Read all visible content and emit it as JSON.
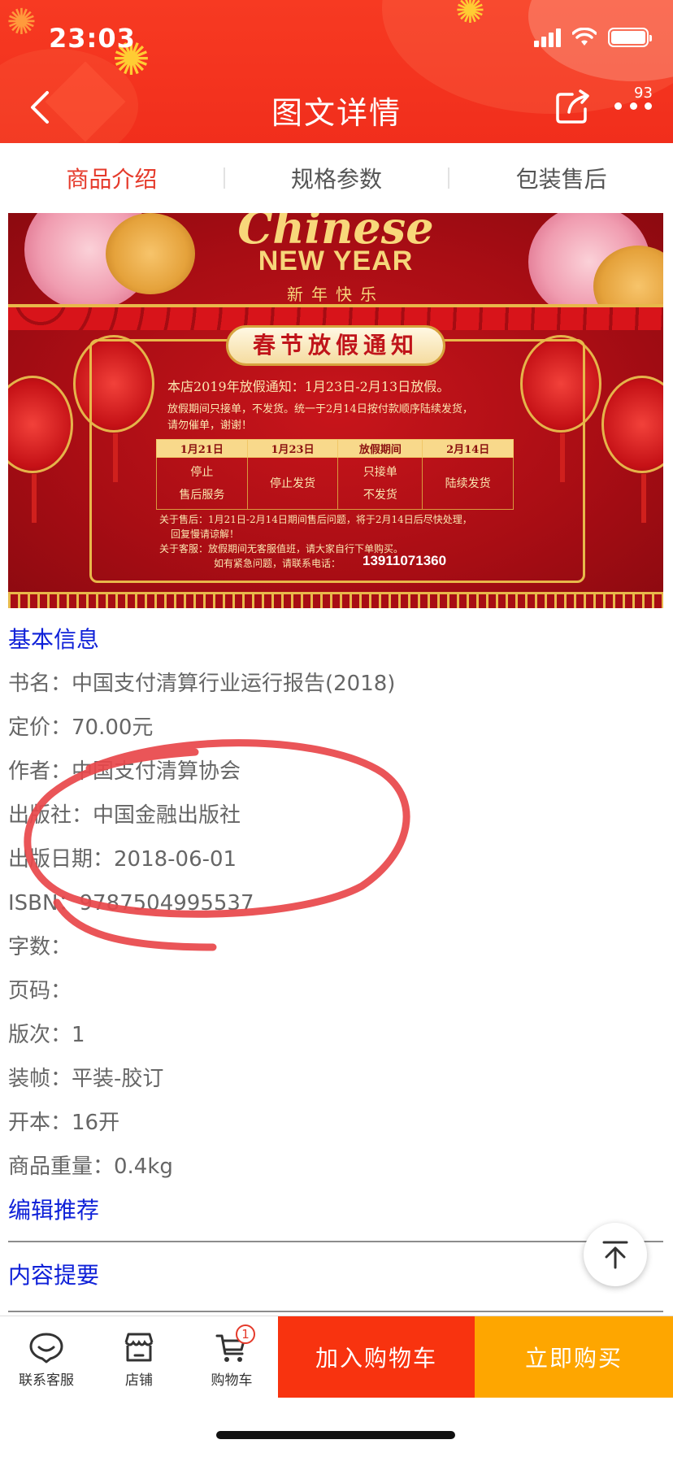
{
  "status_bar": {
    "time": "23:03"
  },
  "nav": {
    "title": "图文详情",
    "more_badge": "93"
  },
  "tabs": [
    {
      "label": "商品介绍",
      "active": true
    },
    {
      "label": "规格参数",
      "active": false
    },
    {
      "label": "包装售后",
      "active": false
    }
  ],
  "banner": {
    "script_text": "Chinese",
    "heading": "NEW YEAR",
    "subheading": "新年快乐",
    "notice_title": "春节放假通知",
    "line1": "本店2019年放假通知：1月23日-2月13日放假。",
    "line2": "放假期间只接单，不发货。统一于2月14日按付款顺序陆续发货，",
    "line3": "请勿催单，谢谢！",
    "table": {
      "headers": [
        "1月21日",
        "1月23日",
        "放假期间",
        "2月14日"
      ],
      "cells": [
        "停止\n售后服务",
        "停止发货",
        "只接单\n不发货",
        "陆续发货"
      ]
    },
    "after_sale": "关于售后：1月21日-2月14日期间售后问题，将于2月14日后尽快处理，",
    "after_sale_cont": "回复慢请谅解！",
    "customer_service": "关于客服：放假期间无客服值班，请大家自行下单购买。",
    "emergency": "如有紧急问题，请联系电话：",
    "phone": "13911071360"
  },
  "info": {
    "basic_title": "基本信息",
    "rows": [
      "书名：中国支付清算行业运行报告(2018)",
      "定价：70.00元",
      "作者：中国支付清算协会",
      "出版社：中国金融出版社",
      "出版日期：2018-06-01",
      "ISBN：9787504995537",
      "字数：",
      "页码：",
      "版次：1",
      "装帧：平装-胶订",
      "开本：16开",
      "商品重量：0.4kg"
    ],
    "editor_title": "编辑推荐",
    "content_title": "内容提要"
  },
  "bottom_bar": {
    "service": "联系客服",
    "shop": "店铺",
    "cart": "购物车",
    "cart_count": "1",
    "add_to_cart": "加入购物车",
    "buy_now": "立即购买"
  },
  "colors": {
    "header": "#f33520",
    "active_tab": "#e53a2b",
    "section_title": "#0f21d8",
    "add_to_cart": "#f8330f",
    "buy_now": "#fea600",
    "annotation": "#e8474a"
  },
  "icons": [
    "back-arrow-icon",
    "share-icon",
    "more-icon",
    "customer-service-icon",
    "shop-icon",
    "cart-icon",
    "back-to-top-icon"
  ]
}
